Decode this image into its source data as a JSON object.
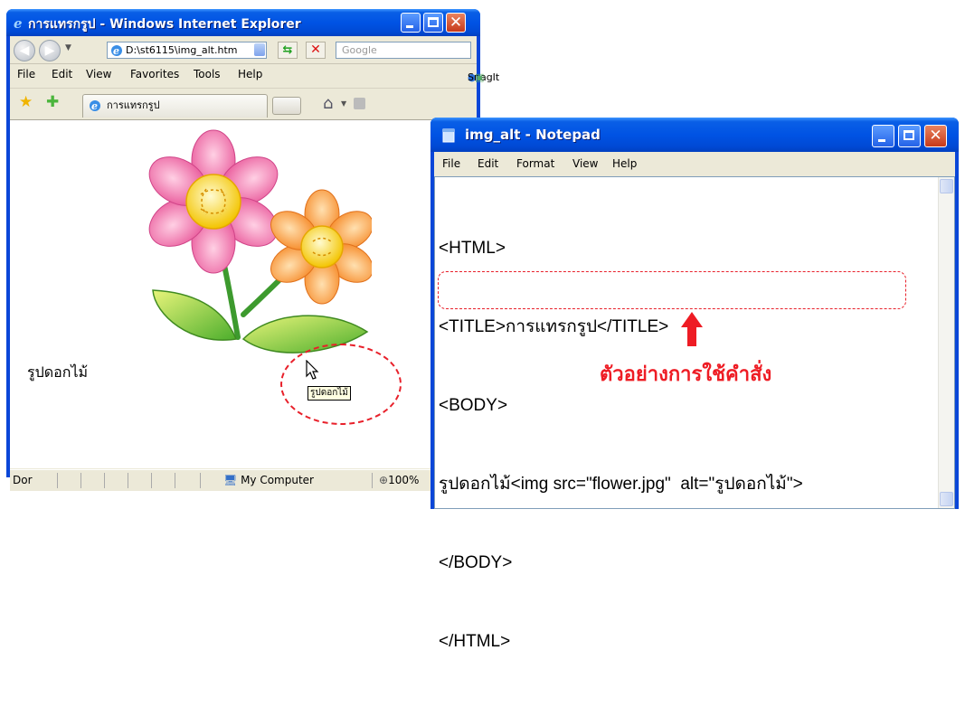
{
  "ie": {
    "title": "การแทรกรูป - Windows Internet Explorer",
    "address": "D:\\st6115\\img_alt.htm",
    "search_placeholder": "Google",
    "menu": [
      "File",
      "Edit",
      "View",
      "Favorites",
      "Tools",
      "Help"
    ],
    "snagit": "SnagIt",
    "tab_title": "การแทรกรูป",
    "page_text": "รูปดอกไม้",
    "status_text": "Dor",
    "status_zone": "My Computer",
    "status_zoom": "100%"
  },
  "tooltip": "รูปดอกไม้",
  "notepad": {
    "title": "img_alt - Notepad",
    "menu": [
      "File",
      "Edit",
      "Format",
      "View",
      "Help"
    ],
    "lines": [
      "<HTML>",
      "<TITLE>การแทรกรูป</TITLE>",
      "<BODY>",
      "รูปดอกไม้<img src=\"flower.jpg\"  alt=\"รูปดอกไม้\">",
      "</BODY>",
      "</HTML>"
    ]
  },
  "annotation": "ตัวอย่างการใช้คำสั่ง",
  "colors": {
    "titlebar": "#0053e4",
    "annotation": "#ee1c24",
    "window_bg": "#ece9d8"
  },
  "icons": [
    "ie-icon",
    "back-icon",
    "forward-icon",
    "refresh-icon",
    "stop-icon",
    "favorites-star-icon",
    "add-favorite-icon",
    "home-icon",
    "feed-icon",
    "notepad-icon",
    "computer-icon",
    "zoom-icon",
    "mouse-cursor-icon",
    "up-arrow-icon"
  ]
}
